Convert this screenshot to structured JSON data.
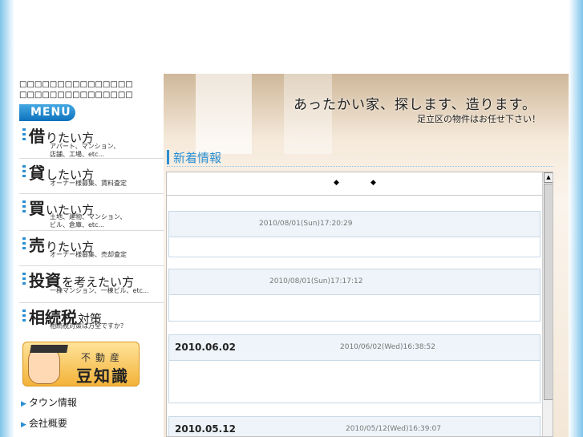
{
  "sidebar": {
    "tagline": [
      "□□□□□□□□□□□□□□□",
      "□□□□□□□□□□□□□□□"
    ],
    "menu_badge": "MENU",
    "items": [
      {
        "big": "借",
        "rest": "りたい方",
        "sub": [
          "アパート、マンション、",
          "店舗、工場、etc..."
        ]
      },
      {
        "big": "貸",
        "rest": "したい方",
        "sub": [
          "オーナー様募集、賃料査定"
        ]
      },
      {
        "big": "買",
        "rest": "いたい方",
        "sub": [
          "土地、建物、マンション、",
          "ビル、倉庫、etc..."
        ]
      },
      {
        "big": "売",
        "rest": "りたい方",
        "sub": [
          "オーナー様募集、売却査定"
        ]
      },
      {
        "big": "投資",
        "rest": "を考えたい方",
        "sub": [
          "一棟マンション、一棟ビル、etc..."
        ]
      },
      {
        "big": "相続税",
        "rest": "対策",
        "sub": [
          "相続税対策は万全ですか？"
        ]
      }
    ],
    "mame_banner": {
      "small": "不動産",
      "large": "豆知識"
    },
    "links": [
      "タウン情報",
      "会社概要"
    ]
  },
  "hero": {
    "title": "あったかい家、探します、造ります。",
    "subtitle": "足立区の物件はお任せ下さい！"
  },
  "news": {
    "heading": "新着情報",
    "nav_symbols": [
      "◆",
      "◆"
    ],
    "entries": [
      {
        "date": "",
        "timestamp": "2010/08/01(Sun)17:20:29"
      },
      {
        "date": "",
        "timestamp": "2010/08/01(Sun)17:17:12"
      },
      {
        "date": "2010.06.02",
        "timestamp": "2010/06/02(Wed)16:38:52"
      },
      {
        "date": "2010.05.12",
        "timestamp": "2010/05/12(Wed)16:39:07"
      }
    ]
  },
  "icons": {
    "scroll_up": "triangle-up-icon",
    "link_arrow": "triangle-right-icon"
  },
  "colors": {
    "accent": "#2a8fd2",
    "menu_badge": "#1f86cf",
    "entry_header": "#eef4f9"
  }
}
